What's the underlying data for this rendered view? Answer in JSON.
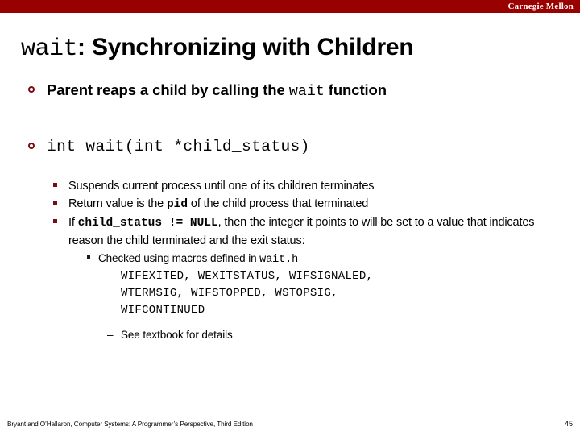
{
  "header": {
    "brand": "Carnegie Mellon",
    "bar_color": "#990000"
  },
  "title": {
    "code_part": "wait",
    "text_part": ": Synchronizing with Children"
  },
  "accent_color": "#7B0B12",
  "bullets": {
    "b1_pre": "Parent reaps a child by calling the ",
    "b1_code": "wait",
    "b1_post": " function",
    "b2_code": "int wait(int *child_status)",
    "s1": "Suspends current process until one of its children terminates",
    "s2_pre": "Return value is the ",
    "s2_code": "pid",
    "s2_post": " of the child process that terminated",
    "s3_pre": "If ",
    "s3_code": "child_status != NULL",
    "s3_post": ", then the integer it points to will be set to  a value that indicates reason the child terminated and the exit status:",
    "t1_pre": "Checked using macros defined in ",
    "t1_code": "wait.h",
    "d1_line1": "WIFEXITED, WEXITSTATUS, WIFSIGNALED,",
    "d1_line2": "WTERMSIG, WIFSTOPPED, WSTOPSIG,",
    "d1_line3": "WIFCONTINUED",
    "d2": "See textbook for details",
    "dash_marker": "–"
  },
  "footer": {
    "citation": "Bryant and O’Hallaron, Computer Systems: A Programmer’s Perspective, Third Edition",
    "page_number": "45"
  }
}
